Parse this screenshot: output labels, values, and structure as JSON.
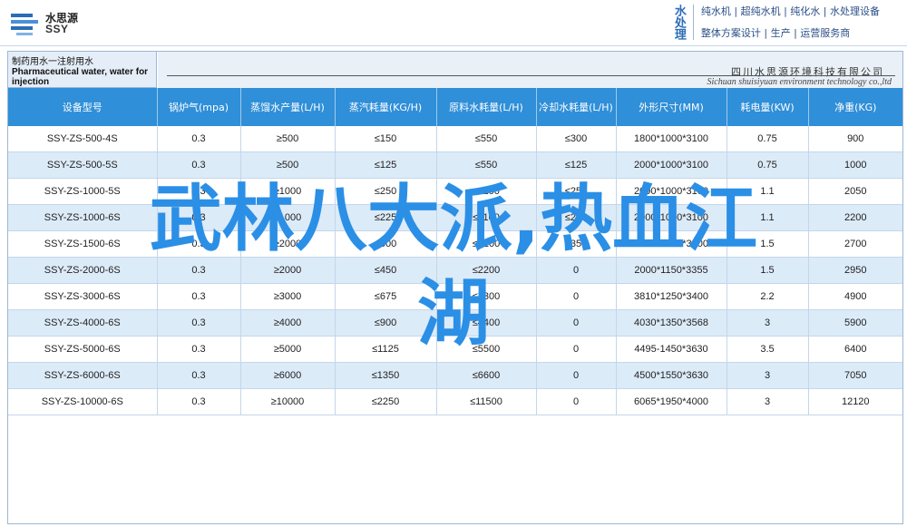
{
  "header": {
    "logo_cn": "水思源",
    "logo_en": "SSY",
    "brand_vertical": "水处理",
    "slogans": [
      "纯水机 | 超纯水机 | 纯化水 | 水处理设备",
      "整体方案设计 | 生产 | 运营服务商"
    ]
  },
  "title": {
    "cn": "制药用水一注射用水",
    "en_line1": "Pharmaceutical water, water for",
    "en_line2": "injection"
  },
  "company": {
    "cn": "四川水思源环境科技有限公司",
    "en": "Sichuan shuisiyuan environment technology co.,ltd"
  },
  "table": {
    "headers": [
      "设备型号",
      "锅炉气(mpa)",
      "蒸馏水产量(L/H)",
      "蒸汽耗量(KG/H)",
      "原料水耗量(L/H)",
      "冷却水耗量(L/H)",
      "外形尺寸(MM)",
      "耗电量(KW)",
      "净重(KG)"
    ],
    "rows": [
      [
        "SSY-ZS-500-4S",
        "0.3",
        "≥500",
        "≤150",
        "≤550",
        "≤300",
        "1800*1000*3100",
        "0.75",
        "900"
      ],
      [
        "SSY-ZS-500-5S",
        "0.3",
        "≥500",
        "≤125",
        "≤550",
        "≤125",
        "2000*1000*3100",
        "0.75",
        "1000"
      ],
      [
        "SSY-ZS-1000-5S",
        "0.3",
        "≥1000",
        "≤250",
        "≤1100",
        "≤250",
        "2000*1000*3100",
        "1.1",
        "2050"
      ],
      [
        "SSY-ZS-1000-6S",
        "0.3",
        "≥1000",
        "≤225",
        "≤1100",
        "≤225",
        "2000*1000*3100",
        "1.1",
        "2200"
      ],
      [
        "SSY-ZS-1500-6S",
        "0.3",
        "≥2000",
        "≤500",
        "≤2200",
        "≤350",
        "2450*1000*3100",
        "1.5",
        "2700"
      ],
      [
        "SSY-ZS-2000-6S",
        "0.3",
        "≥2000",
        "≤450",
        "≤2200",
        "0",
        "2000*1150*3355",
        "1.5",
        "2950"
      ],
      [
        "SSY-ZS-3000-6S",
        "0.3",
        "≥3000",
        "≤675",
        "≤3300",
        "0",
        "3810*1250*3400",
        "2.2",
        "4900"
      ],
      [
        "SSY-ZS-4000-6S",
        "0.3",
        "≥4000",
        "≤900",
        "≤4400",
        "0",
        "4030*1350*3568",
        "3",
        "5900"
      ],
      [
        "SSY-ZS-5000-6S",
        "0.3",
        "≥5000",
        "≤1125",
        "≤5500",
        "0",
        "4495-1450*3630",
        "3.5",
        "6400"
      ],
      [
        "SSY-ZS-6000-6S",
        "0.3",
        "≥6000",
        "≤1350",
        "≤6600",
        "0",
        "4500*1550*3630",
        "3",
        "7050"
      ],
      [
        "SSY-ZS-10000-6S",
        "0.3",
        "≥10000",
        "≤2250",
        "≤11500",
        "0",
        "6065*1950*4000",
        "3",
        "12120"
      ]
    ]
  },
  "overlay": {
    "line1": "武林八大派,热血江",
    "line2": "湖"
  },
  "colors": {
    "header_blue": "#2f8fd8",
    "overlay_blue": "#2b8fe6",
    "row_alt": "#dcebf8"
  }
}
